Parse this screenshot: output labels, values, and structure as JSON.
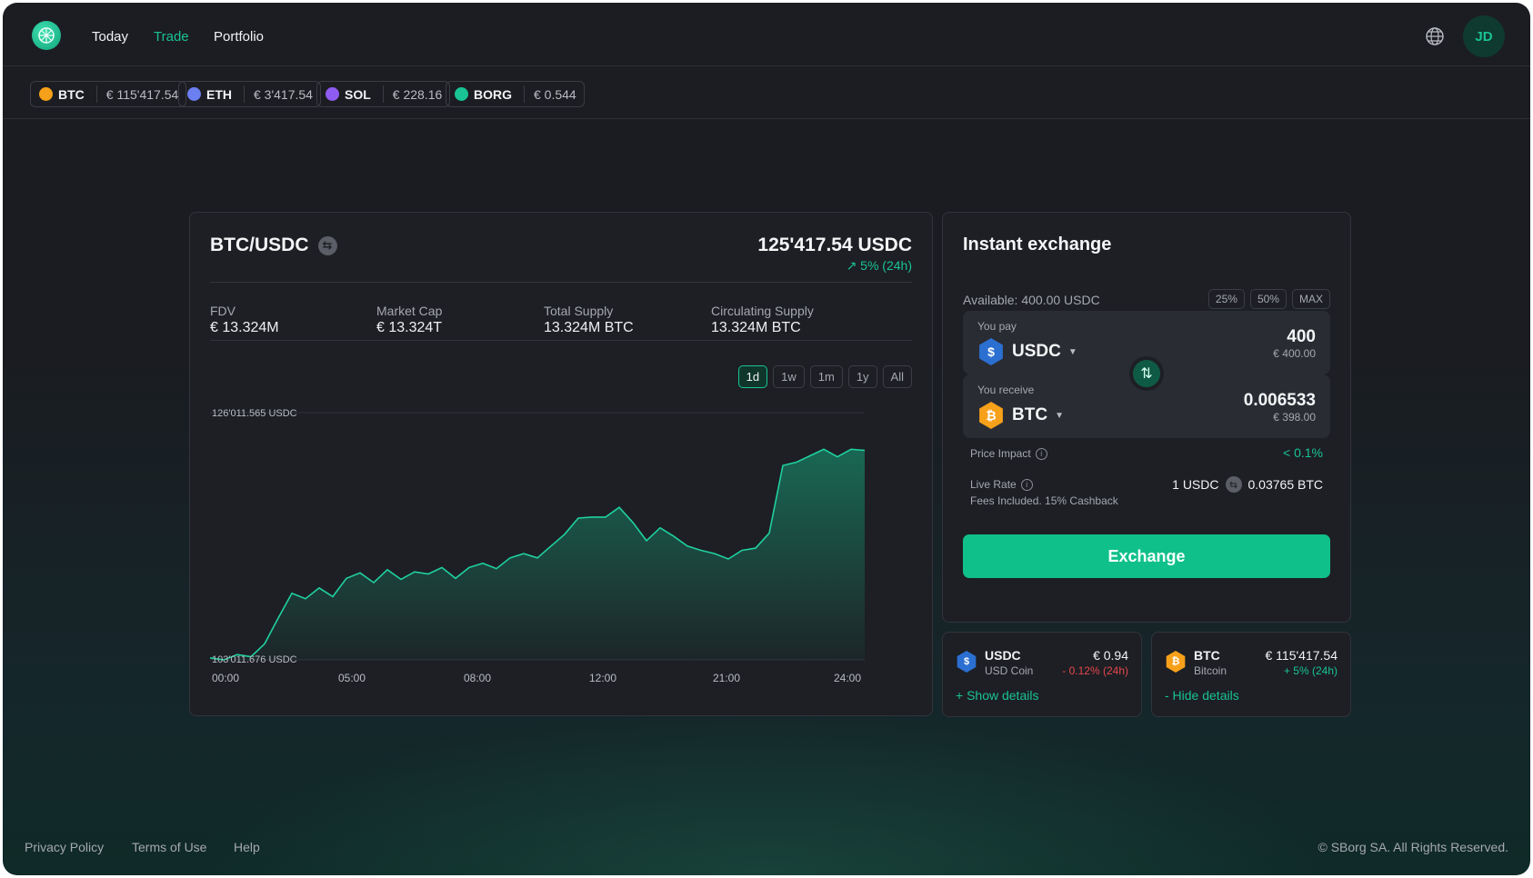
{
  "nav": {
    "items": [
      {
        "label": "Today",
        "active": false
      },
      {
        "label": "Trade",
        "active": true
      },
      {
        "label": "Portfolio",
        "active": false
      }
    ],
    "avatar_initials": "JD"
  },
  "tickers": [
    {
      "symbol": "BTC",
      "price": "€ 115'417.54",
      "color": "#f7a01a",
      "icon": "bitcoin-icon"
    },
    {
      "symbol": "ETH",
      "price": "€ 3'417.54",
      "color": "#6b7ff0",
      "icon": "ethereum-icon"
    },
    {
      "symbol": "SOL",
      "price": "€ 228.16",
      "color": "#8e5cf0",
      "icon": "solana-icon"
    },
    {
      "symbol": "BORG",
      "price": "€ 0.544",
      "color": "#19c393",
      "icon": "borg-icon"
    }
  ],
  "pair": {
    "title": "BTC/USDC",
    "price": "125'417.54 USDC",
    "change": "↗ 5% (24h)"
  },
  "stats": [
    {
      "label": "FDV",
      "value": "€ 13.324M"
    },
    {
      "label": "Market Cap",
      "value": "€ 13.324T"
    },
    {
      "label": "Total Supply",
      "value": "13.324M BTC"
    },
    {
      "label": "Circulating Supply",
      "value": "13.324M BTC"
    }
  ],
  "ranges": [
    {
      "label": "1d",
      "active": true
    },
    {
      "label": "1w",
      "active": false
    },
    {
      "label": "1m",
      "active": false
    },
    {
      "label": "1y",
      "active": false
    },
    {
      "label": "All",
      "active": false
    }
  ],
  "chart_data": {
    "type": "area",
    "y_max_label": "126'011.565 USDC",
    "y_min_label": "103'011.676 USDC",
    "ylim": [
      103011.676,
      126011.565
    ],
    "xlim": [
      0,
      24
    ],
    "x_ticks": [
      "00:00",
      "05:00",
      "08:00",
      "12:00",
      "21:00",
      "24:00"
    ],
    "x": [
      0,
      0.5,
      1.0,
      1.5,
      2.0,
      2.5,
      3.0,
      3.5,
      4.0,
      4.5,
      5.0,
      5.5,
      6.0,
      6.5,
      7.0,
      7.5,
      8.0,
      8.5,
      9.0,
      9.5,
      10.0,
      10.5,
      11.0,
      11.5,
      12.0,
      12.5,
      13.0,
      13.5,
      14.0,
      14.5,
      15.0,
      15.5,
      16.0,
      16.5,
      17.0,
      17.5,
      18.0,
      18.5,
      19.0,
      19.5,
      20.0,
      20.5,
      21.0,
      21.5,
      22.0,
      22.5,
      23.0,
      23.5,
      24.0
    ],
    "values": [
      103200,
      103000,
      103500,
      103300,
      104500,
      106900,
      109200,
      108700,
      109700,
      108900,
      110600,
      111100,
      110200,
      111400,
      110500,
      111200,
      111000,
      111600,
      110600,
      111600,
      112000,
      111500,
      112500,
      112900,
      112500,
      113600,
      114700,
      116200,
      116300,
      116300,
      117200,
      115800,
      114100,
      115300,
      114500,
      113600,
      113200,
      112900,
      112400,
      113200,
      113400,
      114800,
      121100,
      121400,
      122000,
      122600,
      121900,
      122600,
      122500
    ]
  },
  "exchange": {
    "title": "Instant exchange",
    "available": "Available: 400.00 USDC",
    "pct_buttons": [
      "25%",
      "50%",
      "MAX"
    ],
    "pay": {
      "caption": "You pay",
      "token": "USDC",
      "amount": "400",
      "amount_eur": "€ 400.00"
    },
    "receive": {
      "caption": "You receive",
      "token": "BTC",
      "amount": "0.006533",
      "amount_eur": "€ 398.00"
    },
    "price_impact_label": "Price Impact",
    "price_impact_value": "< 0.1%",
    "live_rate_label": "Live Rate",
    "fees_note": "Fees Included. 15% Cashback",
    "rate_from": "1 USDC",
    "rate_to": "0.03765 BTC",
    "button_label": "Exchange"
  },
  "mini_cards": [
    {
      "symbol": "USDC",
      "name": "USD Coin",
      "price": "€ 0.94",
      "change": "- 0.12% (24h)",
      "direction": "down",
      "link": "+ Show details"
    },
    {
      "symbol": "BTC",
      "name": "Bitcoin",
      "price": "€ 115'417.54",
      "change": "+ 5% (24h)",
      "direction": "up",
      "link": "- Hide details"
    }
  ],
  "footer": {
    "links": [
      "Privacy Policy",
      "Terms of Use",
      "Help"
    ],
    "copyright": "© SBorg SA. All Rights Reserved."
  }
}
